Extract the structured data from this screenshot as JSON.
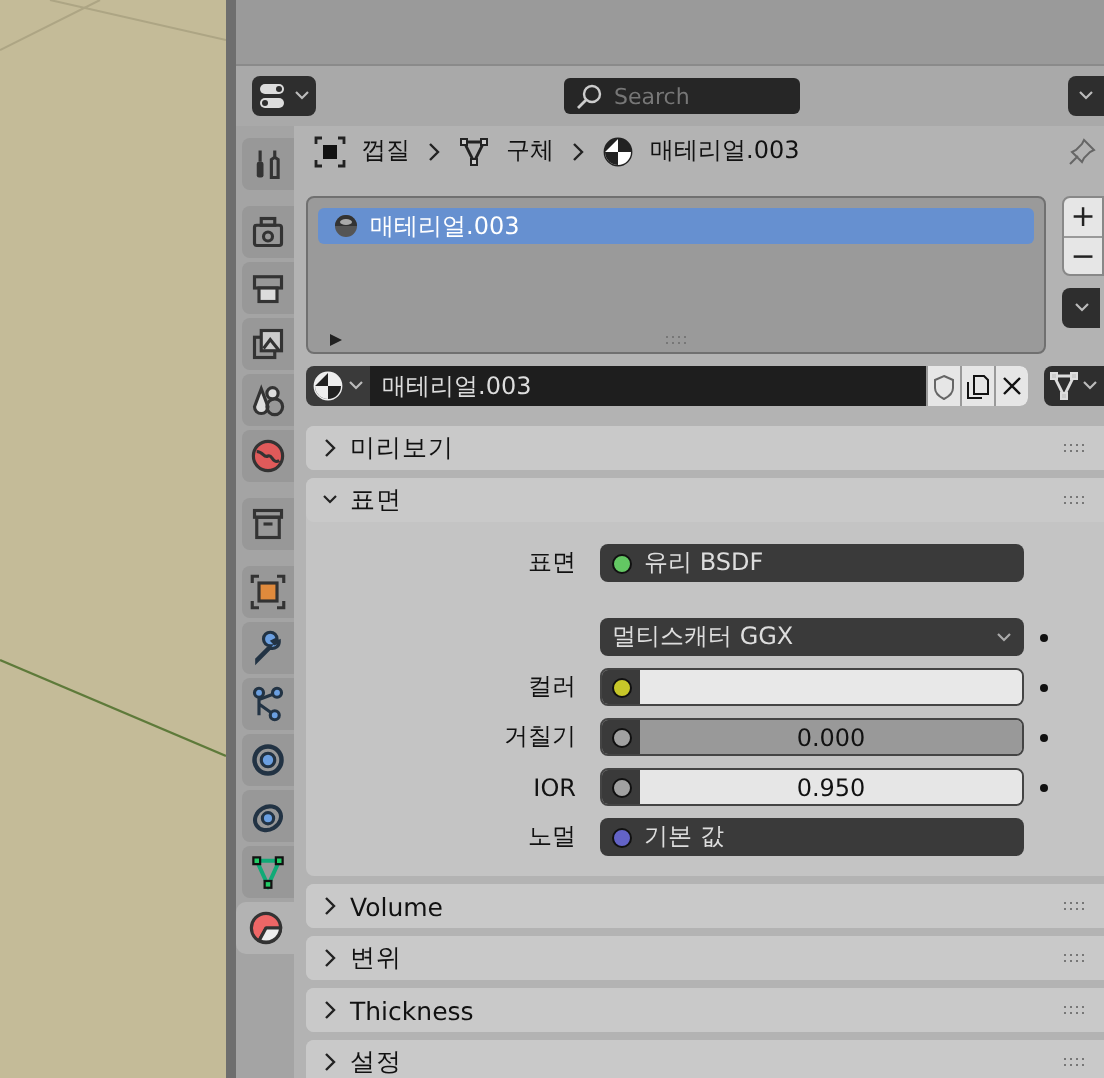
{
  "header": {
    "search": {
      "placeholder": "Search"
    }
  },
  "tab_groups": [
    [
      {
        "kind": "tool",
        "selected": false
      }
    ],
    [
      {
        "kind": "render",
        "selected": false
      },
      {
        "kind": "output",
        "selected": false
      },
      {
        "kind": "view_layer",
        "selected": false
      },
      {
        "kind": "scene",
        "selected": false
      },
      {
        "kind": "world",
        "selected": false
      }
    ],
    [
      {
        "kind": "collection",
        "selected": false
      }
    ],
    [
      {
        "kind": "object",
        "selected": false
      },
      {
        "kind": "modifier",
        "selected": false
      },
      {
        "kind": "particles",
        "selected": false
      },
      {
        "kind": "physics",
        "selected": false
      },
      {
        "kind": "constraints",
        "selected": false
      },
      {
        "kind": "data",
        "selected": false
      },
      {
        "kind": "material",
        "selected": true
      }
    ]
  ],
  "breadcrumb": [
    {
      "kind": "object",
      "label": "껍질"
    },
    {
      "kind": "mesh",
      "label": "구체"
    },
    {
      "kind": "material",
      "label": "매테리얼.003"
    }
  ],
  "material_slots": [
    {
      "label": "매테리얼.003",
      "selected": true
    }
  ],
  "slot_buttons": [
    "+",
    "−"
  ],
  "material_selector": {
    "name": "매테리얼.003"
  },
  "panels": [
    {
      "title": "미리보기",
      "expanded": false
    },
    {
      "title": "표면",
      "expanded": true,
      "properties": [
        {
          "kind": "shader",
          "label": "표면",
          "value": "유리 BSDF",
          "color": "#63c763",
          "animatable": false
        },
        {
          "kind": "enum",
          "value": "멀티스캐터 GGX",
          "animatable": true
        },
        {
          "kind": "color",
          "label": "컬러",
          "color": "#c7c729",
          "animatable": true
        },
        {
          "kind": "slider",
          "label": "거칠기",
          "value": "0.000",
          "color": "#a1a1a1",
          "animatable": true
        },
        {
          "kind": "number",
          "label": "IOR",
          "value": "0.950",
          "color": "#a1a1a1",
          "animatable": true
        },
        {
          "kind": "shader",
          "label": "노멀",
          "value": "기본 값",
          "color": "#6363c7",
          "animatable": false
        }
      ]
    },
    {
      "title": "Volume",
      "expanded": false
    },
    {
      "title": "변위",
      "expanded": false
    },
    {
      "title": "Thickness",
      "expanded": false
    },
    {
      "title": "설정",
      "expanded": false
    }
  ]
}
